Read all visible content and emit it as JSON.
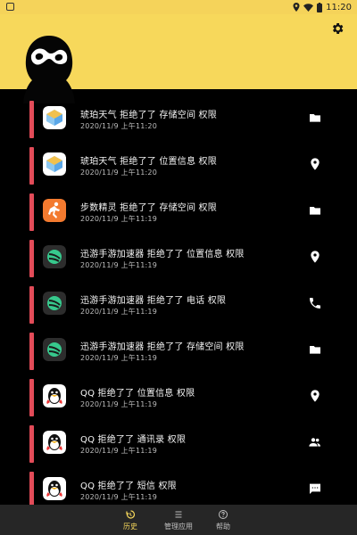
{
  "statusbar": {
    "time": "11:20",
    "left_icon": "screenshot-icon",
    "right_icons": [
      "location-icon",
      "wifi-icon",
      "battery-icon"
    ]
  },
  "header": {
    "avatar": "sunglasses-character-avatar",
    "settings_icon": "gear-icon",
    "background_color": "#f7d85b"
  },
  "records": [
    {
      "app": "琥珀天气",
      "icon": "weather-app-icon",
      "text": "琥珀天气  拒绝了了  存储空间  权限",
      "time": "2020/11/9  上午11:20",
      "action_icon": "folder-icon"
    },
    {
      "app": "琥珀天气",
      "icon": "weather-app-icon",
      "text": "琥珀天气  拒绝了了  位置信息  权限",
      "time": "2020/11/9  上午11:20",
      "action_icon": "location-pin-icon"
    },
    {
      "app": "步数精灵",
      "icon": "pedometer-app-icon",
      "text": "步数精灵  拒绝了了  存储空间  权限",
      "time": "2020/11/9  上午11:19",
      "action_icon": "folder-icon"
    },
    {
      "app": "迅游手游加速器",
      "icon": "xunyou-app-icon",
      "text": "迅游手游加速器  拒绝了了  位置信息  权限",
      "time": "2020/11/9  上午11:19",
      "action_icon": "location-pin-icon"
    },
    {
      "app": "迅游手游加速器",
      "icon": "xunyou-app-icon",
      "text": "迅游手游加速器  拒绝了了  电话  权限",
      "time": "2020/11/9  上午11:19",
      "action_icon": "phone-icon"
    },
    {
      "app": "迅游手游加速器",
      "icon": "xunyou-app-icon",
      "text": "迅游手游加速器  拒绝了了  存储空间  权限",
      "time": "2020/11/9  上午11:19",
      "action_icon": "folder-icon"
    },
    {
      "app": "QQ",
      "icon": "qq-penguin-icon",
      "text": "QQ  拒绝了了  位置信息  权限",
      "time": "2020/11/9  上午11:19",
      "action_icon": "location-pin-icon"
    },
    {
      "app": "QQ",
      "icon": "qq-penguin-icon",
      "text": "QQ  拒绝了了  通讯录  权限",
      "time": "2020/11/9  上午11:19",
      "action_icon": "contacts-icon"
    },
    {
      "app": "QQ",
      "icon": "qq-penguin-icon",
      "text": "QQ  拒绝了了  短信  权限",
      "time": "2020/11/9  上午11:19",
      "action_icon": "sms-icon"
    }
  ],
  "bottom_nav": [
    {
      "label": "历史",
      "icon": "history-icon",
      "active": true
    },
    {
      "label": "管理应用",
      "icon": "manage-apps-icon",
      "active": false
    },
    {
      "label": "帮助",
      "icon": "help-icon",
      "active": false
    }
  ],
  "colors": {
    "accent_bar": "#e24b58",
    "header_yellow": "#f7d85b",
    "list_background": "#000000",
    "bottom_bar": "#262626"
  }
}
